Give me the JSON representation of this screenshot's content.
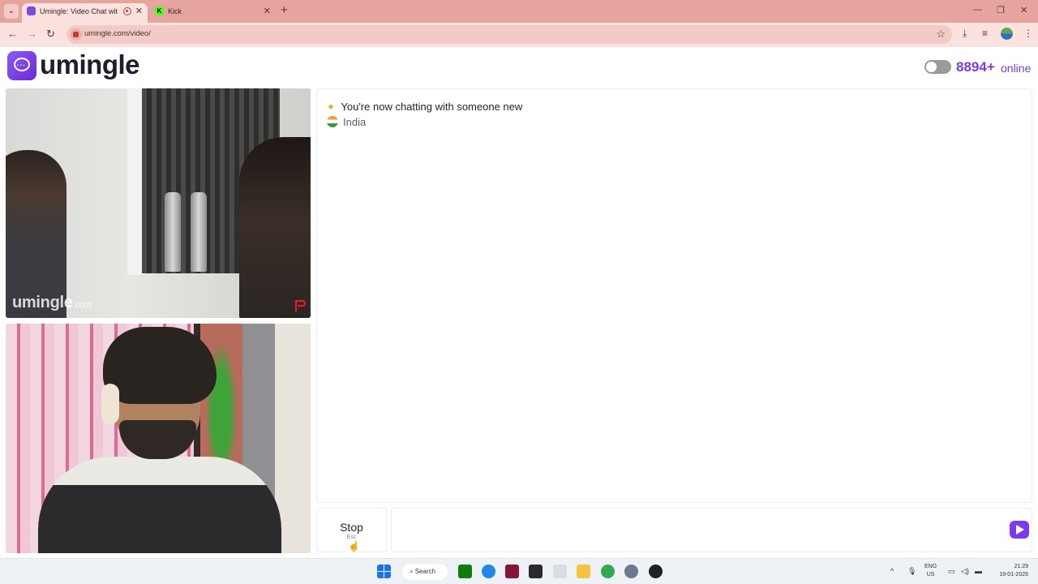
{
  "browser": {
    "tabs": [
      {
        "label": "Umingle: Video Chat with S",
        "active": true,
        "recording": true
      },
      {
        "label": "Kick",
        "active": false
      }
    ],
    "address": "umingle.com/video/"
  },
  "header": {
    "logo_text": "umingle",
    "online_count": "8894+",
    "online_label": "online",
    "toggle_on": false
  },
  "videos": {
    "watermark": "umingle",
    "watermark_suffix": ".com"
  },
  "chat": {
    "status_message": "You're now chatting with someone new",
    "country": "India"
  },
  "controls": {
    "stop_label": "Stop",
    "stop_hint": "Esc",
    "message_value": ""
  },
  "taskbar": {
    "search_label": "Search",
    "lang_top": "ENG",
    "lang_bottom": "US",
    "time": "21:29",
    "date": "19-01-2026"
  },
  "colors": {
    "accent": "#7c3aed",
    "tabstrip": "#e6a49e",
    "toolbar": "#fbe2de"
  }
}
